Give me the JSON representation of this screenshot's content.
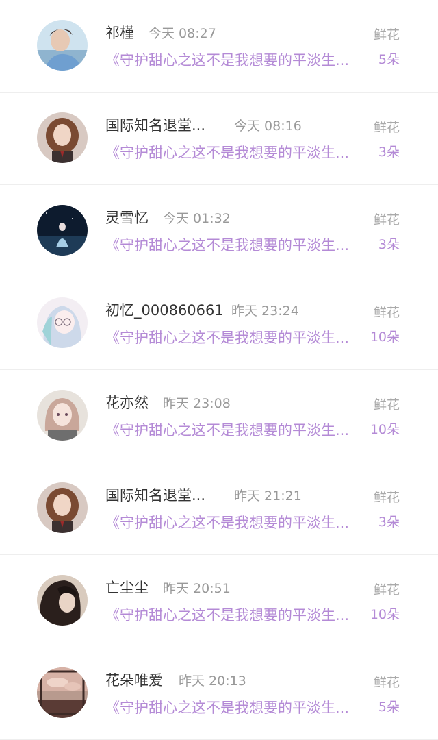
{
  "gift_label": "鲜花",
  "records": [
    {
      "name": "祁槿",
      "time": "今天 08:27",
      "title": "《守护甜心之这不是我想要的平淡生...",
      "count": "5朵"
    },
    {
      "name": "国际知名退堂...",
      "time": "今天 08:16",
      "title": "《守护甜心之这不是我想要的平淡生...",
      "count": "3朵"
    },
    {
      "name": "灵雪忆",
      "time": "今天 01:32",
      "title": "《守护甜心之这不是我想要的平淡生...",
      "count": "3朵"
    },
    {
      "name": "初忆_000860661",
      "time": "昨天 23:24",
      "title": "《守护甜心之这不是我想要的平淡生...",
      "count": "10朵"
    },
    {
      "name": "花亦然",
      "time": "昨天 23:08",
      "title": "《守护甜心之这不是我想要的平淡生...",
      "count": "10朵"
    },
    {
      "name": "国际知名退堂...",
      "time": "昨天 21:21",
      "title": "《守护甜心之这不是我想要的平淡生...",
      "count": "3朵"
    },
    {
      "name": "亡尘尘",
      "time": "昨天 20:51",
      "title": "《守护甜心之这不是我想要的平淡生...",
      "count": "10朵"
    },
    {
      "name": "花朵唯爱",
      "time": "昨天 20:13",
      "title": "《守护甜心之这不是我想要的平淡生...",
      "count": "5朵"
    }
  ],
  "colors": {
    "accent_purple": "#b48ad6",
    "name_text": "#333333",
    "muted_text": "#999999"
  }
}
